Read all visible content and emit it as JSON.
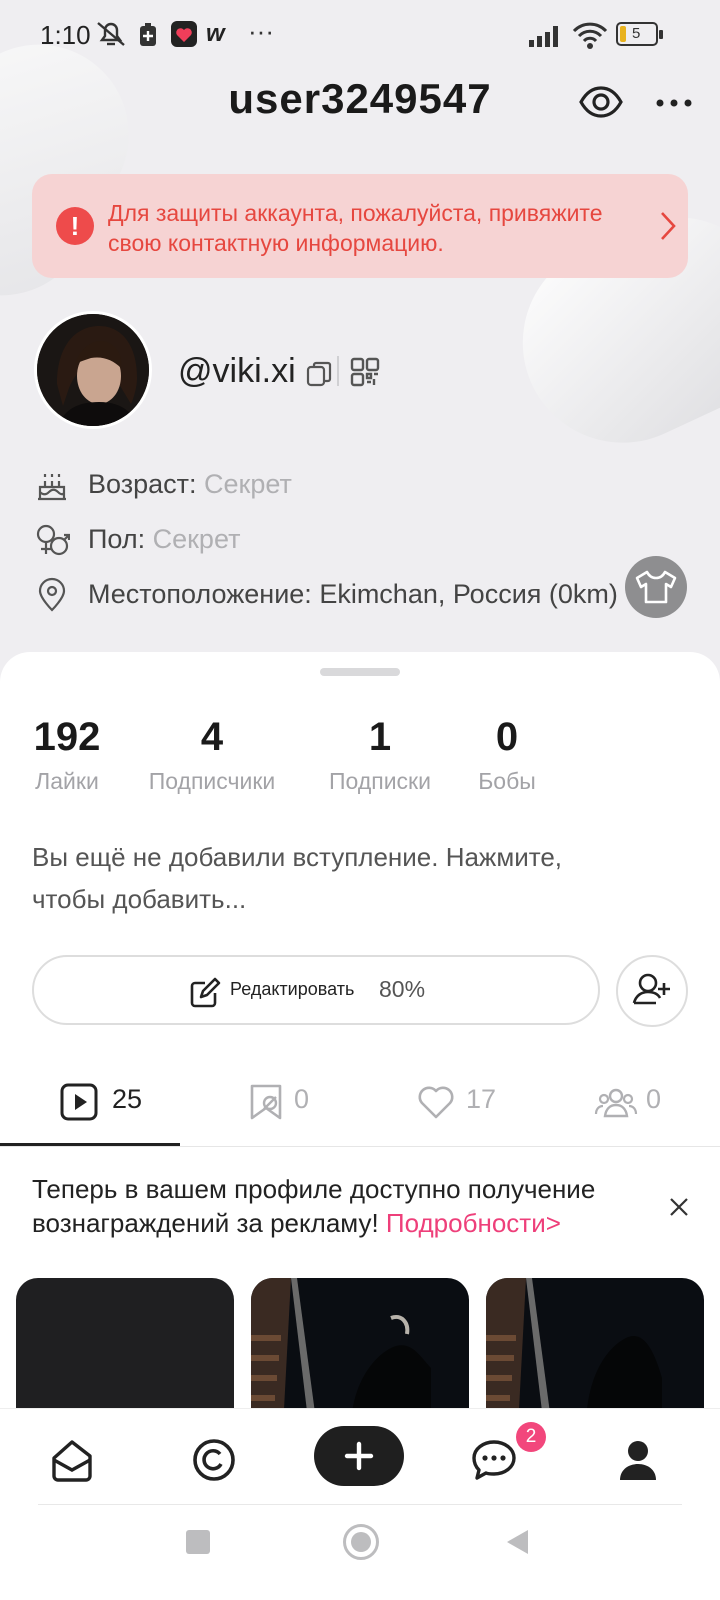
{
  "status_bar": {
    "time": "1:10",
    "more": "···",
    "battery_level": "5"
  },
  "header": {
    "title": "user3249547"
  },
  "alert": {
    "text": "Для защиты аккаунта, пожалуйста, привяжите свою контактную информацию."
  },
  "profile": {
    "handle": "@viki.xi",
    "age_label": "Возраст:",
    "age_value": "Секрет",
    "gender_label": "Пол:",
    "gender_value": "Секрет",
    "location_label": "Местоположение:",
    "location_value": "Ekimchan, Россия (0km)"
  },
  "stats": [
    {
      "value": "192",
      "label": "Лайки"
    },
    {
      "value": "4",
      "label": "Подписчики"
    },
    {
      "value": "1",
      "label": "Подписки"
    },
    {
      "value": "0",
      "label": "Бобы"
    }
  ],
  "intro": "Вы ещё не добавили вступление. Нажмите, чтобы добавить...",
  "edit": {
    "label": "Редактировать",
    "percent": "80%"
  },
  "tabs": [
    {
      "icon": "video-icon",
      "count": "25"
    },
    {
      "icon": "bookmark-icon",
      "count": "0"
    },
    {
      "icon": "heart-icon",
      "count": "17"
    },
    {
      "icon": "friends-icon",
      "count": "0"
    }
  ],
  "promo": {
    "text": "Теперь в вашем профиле доступно получение вознаграждений за рекламу! ",
    "link": "Подробности>"
  },
  "nav": {
    "messages_badge": "2"
  },
  "colors": {
    "accent_pink": "#ee3f7a",
    "alert_red": "#e6473f",
    "alert_bg": "#f6d3d3"
  }
}
